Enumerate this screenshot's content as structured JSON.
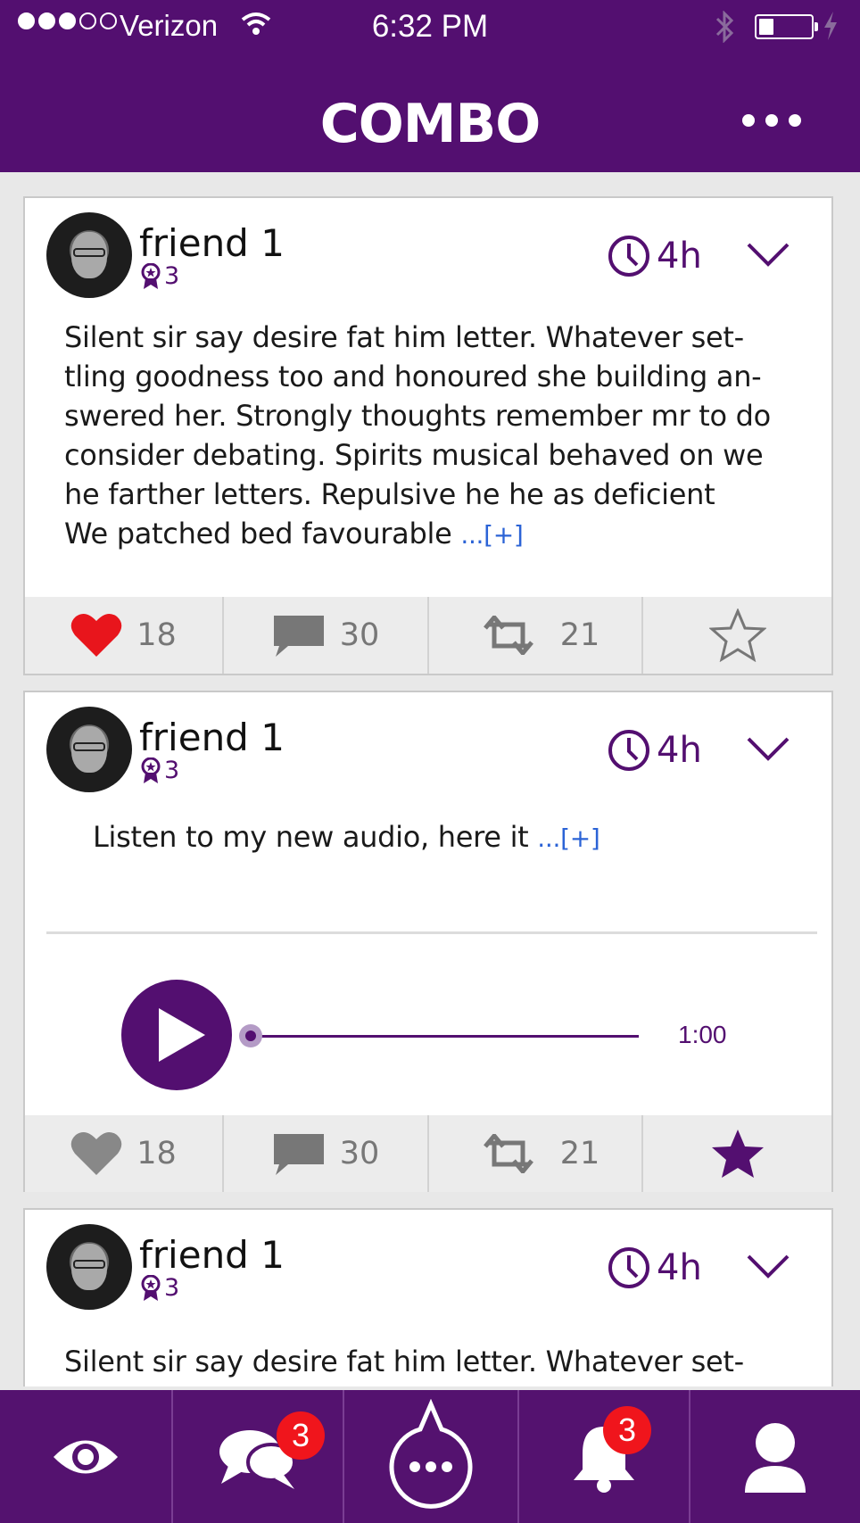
{
  "status_bar": {
    "carrier": "Verizon",
    "time": "6:32 PM",
    "signal_bars_filled": 3,
    "signal_bars_total": 5,
    "battery_level": 0.25
  },
  "header": {
    "title": "COMBO",
    "menu_icon": "more-horizontal-icon"
  },
  "colors": {
    "brand": "#530f70",
    "badge": "#f0151c",
    "like_active": "#e8151c",
    "link": "#2b63d6"
  },
  "posts": [
    {
      "author": "friend 1",
      "rank": "3",
      "time": "4h",
      "text_lines": [
        "Silent sir say desire fat him letter. Whatever set-",
        "tling goodness too and honoured she building an-",
        "swered her. Strongly thoughts remember mr to do",
        "consider debating. Spirits musical behaved on we",
        "he farther letters. Repulsive he he as deficient",
        "We patched bed favourable"
      ],
      "more_link": "...[+]",
      "likes": "18",
      "comments": "30",
      "reposts": "21",
      "liked": true,
      "starred": false
    },
    {
      "author": "friend 1",
      "rank": "3",
      "time": "4h",
      "text": "Listen to my new audio, here it",
      "more_link": "...[+]",
      "audio_duration": "1:00",
      "audio_progress": 0,
      "likes": "18",
      "comments": "30",
      "reposts": "21",
      "liked": false,
      "starred": true
    },
    {
      "author": "friend 1",
      "rank": "3",
      "time": "4h",
      "text": "Silent sir say desire fat him letter. Whatever set-"
    }
  ],
  "tabs": [
    {
      "name": "eye-icon",
      "badge": ""
    },
    {
      "name": "chat-bubbles-icon",
      "badge": "3"
    },
    {
      "name": "compose-bubble-icon",
      "badge": ""
    },
    {
      "name": "bell-icon",
      "badge": "3"
    },
    {
      "name": "profile-icon",
      "badge": ""
    }
  ]
}
